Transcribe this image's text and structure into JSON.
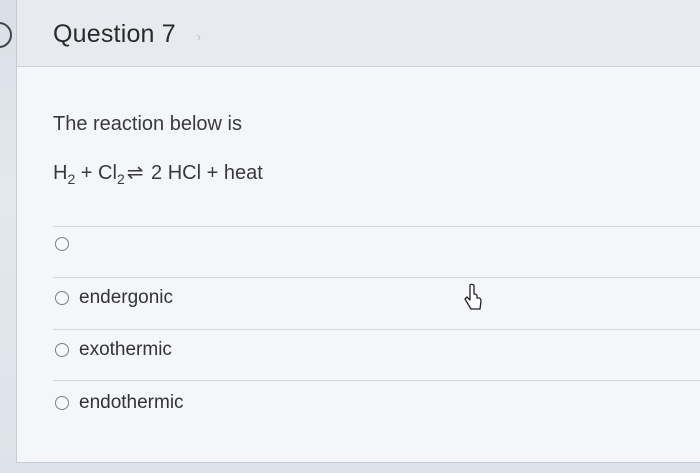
{
  "question": {
    "title": "Question 7",
    "prompt": "The reaction below is",
    "equation": {
      "h": "H",
      "h_sub": "2",
      "plus1": " + ",
      "cl": "Cl",
      "cl_sub": "2",
      "arrow": "⇌",
      "rhs": " 2 HCl + heat"
    }
  },
  "options": [
    {
      "label": ""
    },
    {
      "label": "endergonic"
    },
    {
      "label": "exothermic"
    },
    {
      "label": "endothermic"
    }
  ],
  "icons": {
    "cursor": "pointer-cursor-icon",
    "radio": "radio-unselected-icon"
  }
}
